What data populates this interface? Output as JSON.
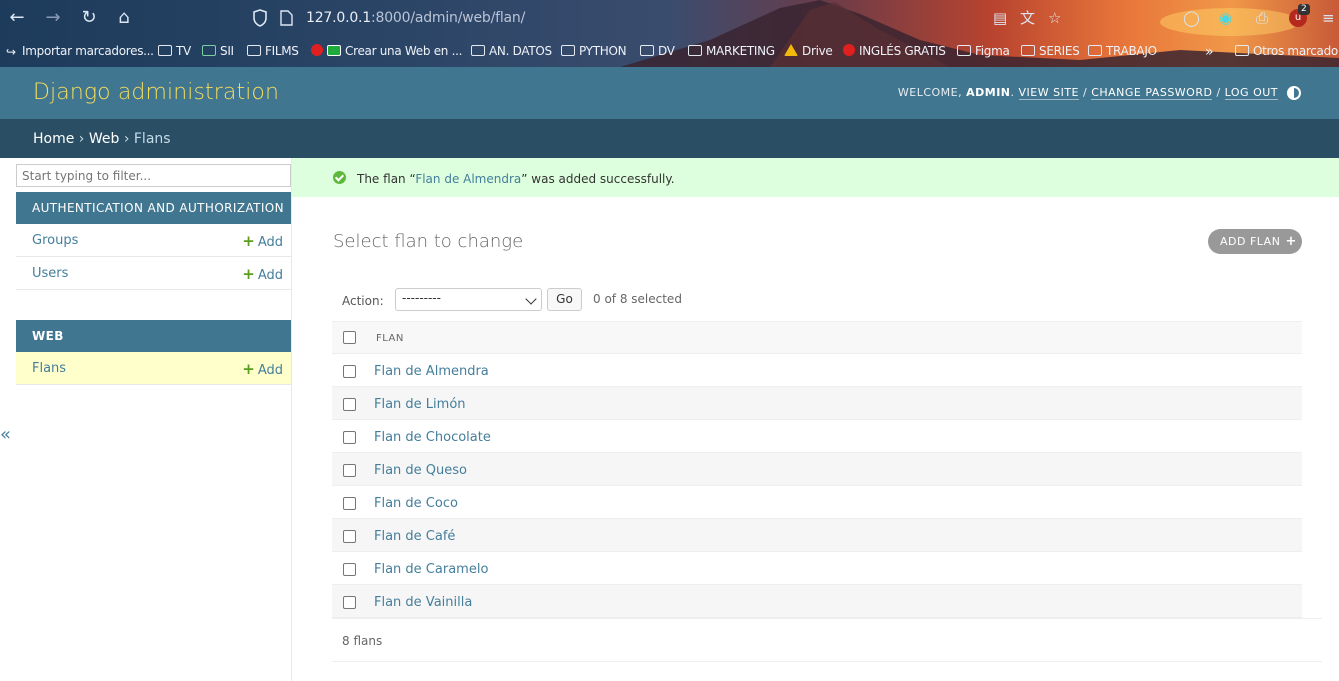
{
  "browser": {
    "url_host": "127.0.0.1",
    "url_rest": ":8000/admin/web/flan/",
    "extension_count": "2",
    "bookmarks": [
      {
        "label": "Importar marcadores...",
        "icon": "import-icon"
      },
      {
        "label": "TV",
        "icon": "folder-icon"
      },
      {
        "label": "SII",
        "icon": "sii-icon"
      },
      {
        "label": "FILMS",
        "icon": "folder-icon"
      },
      {
        "label": "Crear una Web en ...",
        "icon": "youtube-icon"
      },
      {
        "label": "AN. DATOS",
        "icon": "folder-icon"
      },
      {
        "label": "PYTHON",
        "icon": "folder-icon"
      },
      {
        "label": "DV",
        "icon": "folder-icon"
      },
      {
        "label": "MARKETING",
        "icon": "folder-icon"
      },
      {
        "label": "Drive",
        "icon": "drive-icon"
      },
      {
        "label": "INGLÉS GRATIS",
        "icon": "youtube-icon"
      },
      {
        "label": "Figma",
        "icon": "folder-icon"
      },
      {
        "label": "SERIES",
        "icon": "folder-icon"
      },
      {
        "label": "TRABAJO",
        "icon": "folder-icon"
      },
      {
        "label": "Otros marcadores",
        "icon": "folder-icon"
      }
    ]
  },
  "header": {
    "branding": "Django administration",
    "welcome": "WELCOME,",
    "user": "ADMIN",
    "view_site": "VIEW SITE",
    "change_password": "CHANGE PASSWORD",
    "log_out": "LOG OUT"
  },
  "breadcrumbs": {
    "home": "Home",
    "app": "Web",
    "current": "Flans"
  },
  "sidebar": {
    "filter_placeholder": "Start typing to filter...",
    "modules": [
      {
        "caption": "AUTHENTICATION AND AUTHORIZATION",
        "models": [
          {
            "name": "Groups",
            "add": "Add"
          },
          {
            "name": "Users",
            "add": "Add"
          }
        ]
      },
      {
        "caption": "WEB",
        "models": [
          {
            "name": "Flans",
            "add": "Add"
          }
        ]
      }
    ],
    "collapse_label": "«"
  },
  "message": {
    "prefix": "The flan “",
    "object": "Flan de Almendra",
    "suffix": "” was added successfully."
  },
  "content": {
    "title": "Select flan to change",
    "add_button": "ADD FLAN",
    "action_label": "Action:",
    "action_selected": "---------",
    "go_label": "Go",
    "counter": "0 of 8 selected",
    "column_header": "FLAN",
    "rows": [
      "Flan de Almendra",
      "Flan de Limón",
      "Flan de Chocolate",
      "Flan de Queso",
      "Flan de Coco",
      "Flan de Café",
      "Flan de Caramelo",
      "Flan de Vainilla"
    ],
    "paginator": "8 flans"
  },
  "colors": {
    "header_bg": "#417690",
    "breadcrumbs_bg": "#2a4e63",
    "branding": "#f5dd5d",
    "link": "#447e9b",
    "success_bg": "#dfd",
    "current_row": "#ffffcc"
  }
}
